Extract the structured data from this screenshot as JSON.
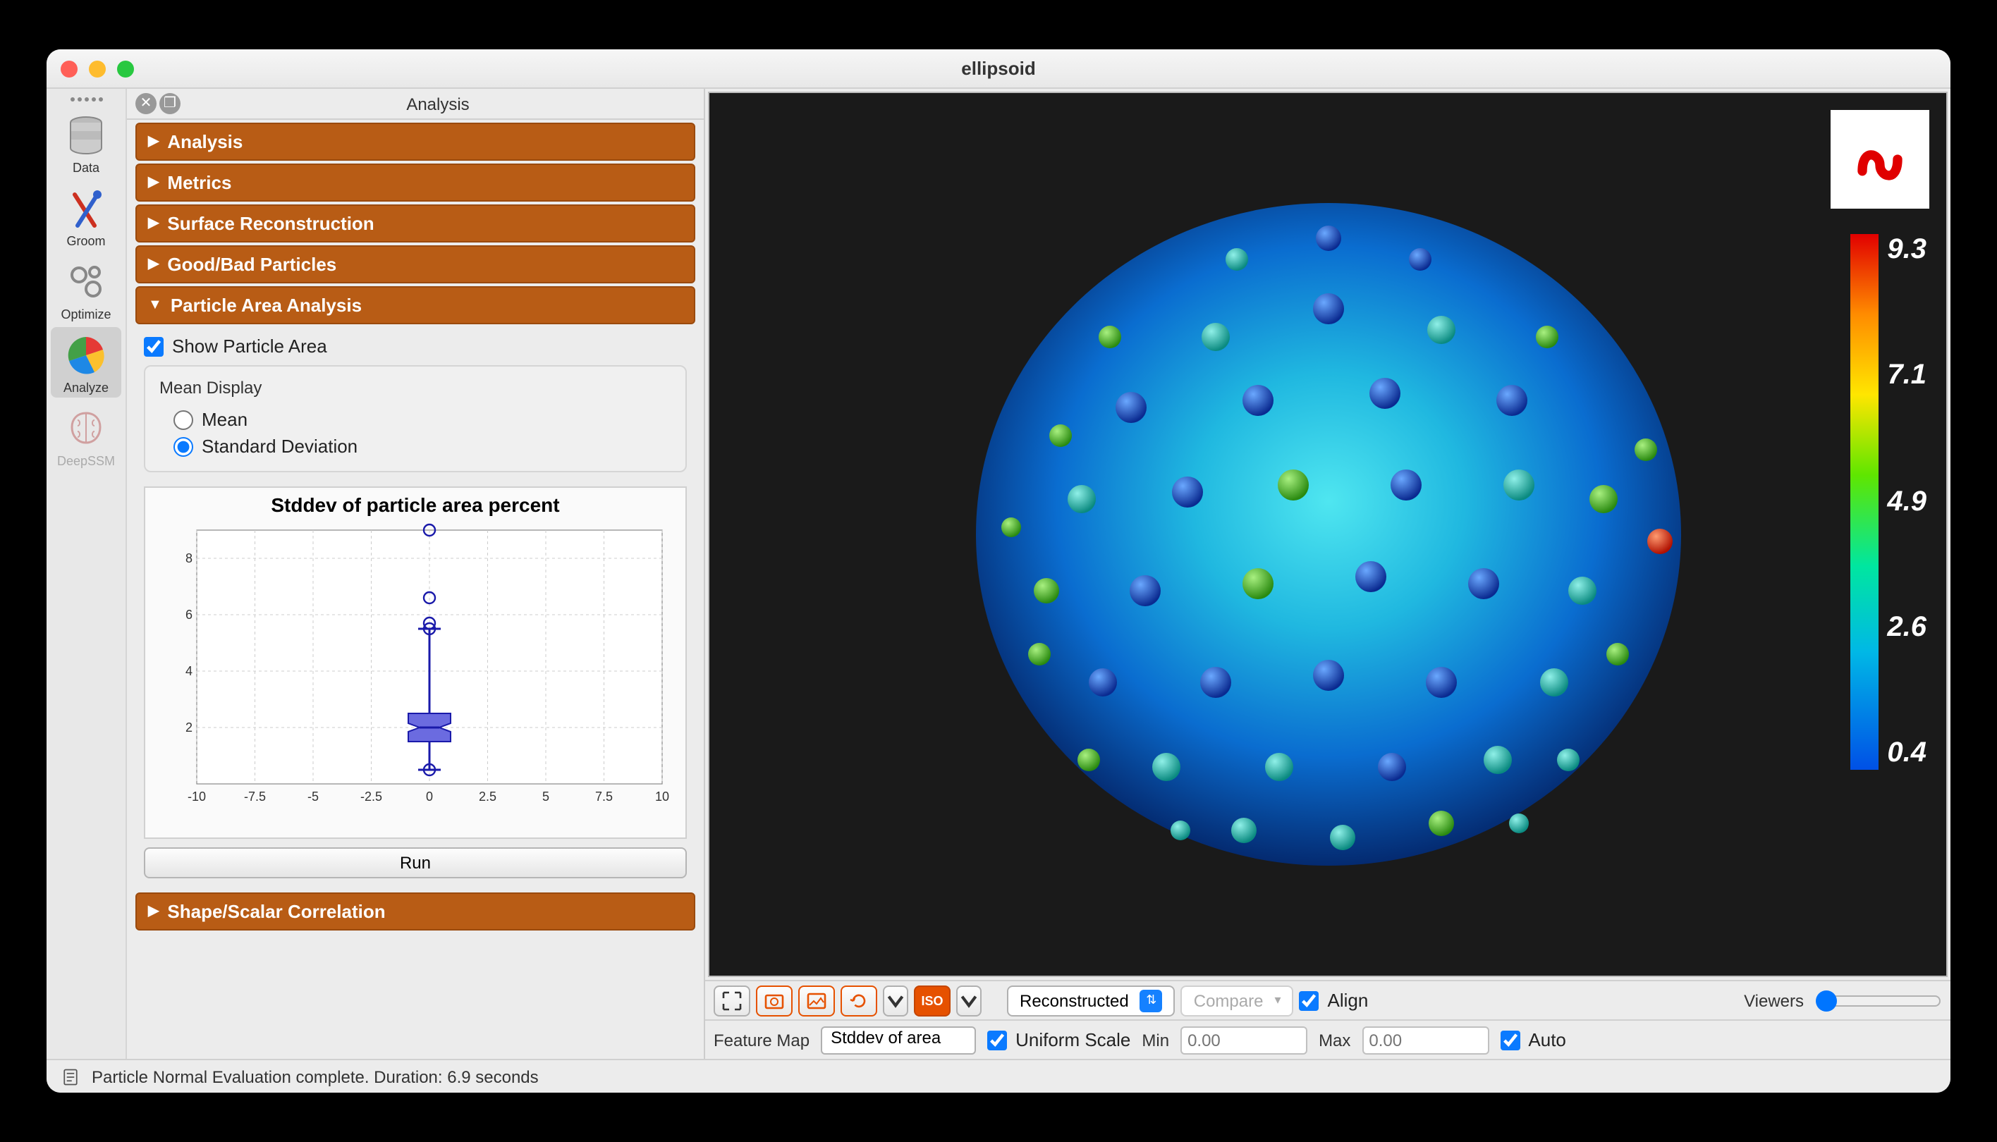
{
  "window": {
    "title": "ellipsoid"
  },
  "rail": {
    "items": [
      {
        "label": "Data"
      },
      {
        "label": "Groom"
      },
      {
        "label": "Optimize"
      },
      {
        "label": "Analyze"
      },
      {
        "label": "DeepSSM"
      }
    ],
    "active": 3
  },
  "panel": {
    "title": "Analysis",
    "sections": {
      "analysis": "Analysis",
      "metrics": "Metrics",
      "surface": "Surface Reconstruction",
      "goodbad": "Good/Bad Particles",
      "particle_area": "Particle Area Analysis",
      "shape_scalar": "Shape/Scalar Correlation"
    },
    "particle_area": {
      "show_checkbox": "Show Particle Area",
      "show_checked": true,
      "mean_display_legend": "Mean Display",
      "radio_mean": "Mean",
      "radio_std": "Standard Deviation",
      "radio_selected": "std",
      "chart_title": "Stddev of particle area percent",
      "run_button": "Run"
    }
  },
  "viewer": {
    "colorbar_labels": [
      "9.3",
      "7.1",
      "4.9",
      "2.6",
      "0.4"
    ],
    "toolbar": {
      "reconstructed": "Reconstructed",
      "compare": "Compare",
      "align_label": "Align",
      "align_checked": true,
      "viewers_label": "Viewers"
    },
    "feature_map": {
      "label": "Feature Map",
      "selected": "Stddev of area",
      "uniform_scale_label": "Uniform Scale",
      "uniform_scale_checked": true,
      "min_label": "Min",
      "min_value": "0.00",
      "max_label": "Max",
      "max_value": "0.00",
      "auto_label": "Auto",
      "auto_checked": true
    }
  },
  "status": {
    "message": "Particle Normal Evaluation complete.  Duration: 6.9 seconds"
  },
  "chart_data": {
    "type": "boxplot",
    "title": "Stddev of particle area percent",
    "xlabel": "",
    "ylabel": "",
    "xlim": [
      -10,
      10
    ],
    "ylim": [
      0,
      9
    ],
    "x_ticks": [
      -10,
      -7.5,
      -5,
      -2.5,
      0,
      2.5,
      5,
      7.5,
      10
    ],
    "y_ticks": [
      2,
      4,
      6,
      8
    ],
    "series": [
      {
        "name": "stddev",
        "x": 0,
        "q1": 1.5,
        "median": 2.0,
        "q3": 2.5,
        "whisker_low": 0.5,
        "whisker_high": 5.5,
        "outliers": [
          5.5,
          5.7,
          6.6,
          9.0
        ]
      }
    ]
  }
}
